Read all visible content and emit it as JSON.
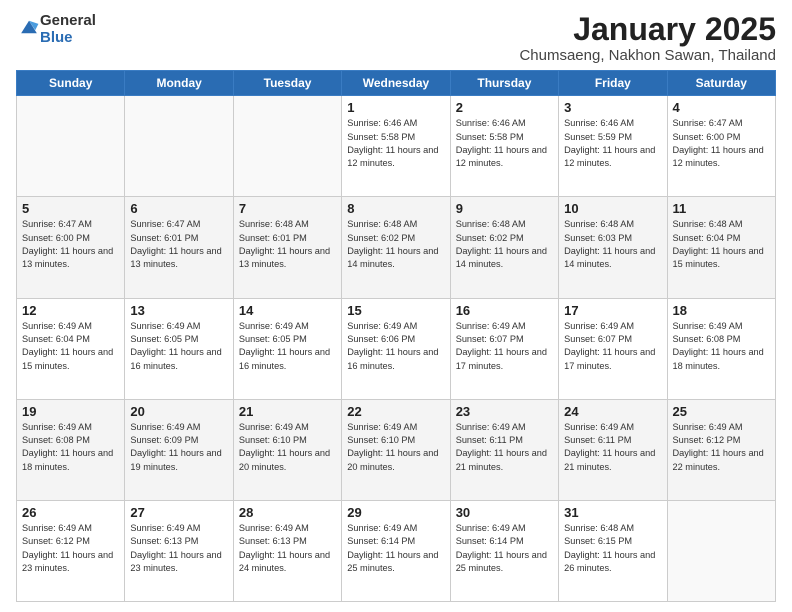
{
  "header": {
    "logo_general": "General",
    "logo_blue": "Blue",
    "title": "January 2025",
    "subtitle": "Chumsaeng, Nakhon Sawan, Thailand"
  },
  "days_of_week": [
    "Sunday",
    "Monday",
    "Tuesday",
    "Wednesday",
    "Thursday",
    "Friday",
    "Saturday"
  ],
  "weeks": [
    [
      {
        "day": "",
        "info": ""
      },
      {
        "day": "",
        "info": ""
      },
      {
        "day": "",
        "info": ""
      },
      {
        "day": "1",
        "info": "Sunrise: 6:46 AM\nSunset: 5:58 PM\nDaylight: 11 hours and 12 minutes."
      },
      {
        "day": "2",
        "info": "Sunrise: 6:46 AM\nSunset: 5:58 PM\nDaylight: 11 hours and 12 minutes."
      },
      {
        "day": "3",
        "info": "Sunrise: 6:46 AM\nSunset: 5:59 PM\nDaylight: 11 hours and 12 minutes."
      },
      {
        "day": "4",
        "info": "Sunrise: 6:47 AM\nSunset: 6:00 PM\nDaylight: 11 hours and 12 minutes."
      }
    ],
    [
      {
        "day": "5",
        "info": "Sunrise: 6:47 AM\nSunset: 6:00 PM\nDaylight: 11 hours and 13 minutes."
      },
      {
        "day": "6",
        "info": "Sunrise: 6:47 AM\nSunset: 6:01 PM\nDaylight: 11 hours and 13 minutes."
      },
      {
        "day": "7",
        "info": "Sunrise: 6:48 AM\nSunset: 6:01 PM\nDaylight: 11 hours and 13 minutes."
      },
      {
        "day": "8",
        "info": "Sunrise: 6:48 AM\nSunset: 6:02 PM\nDaylight: 11 hours and 14 minutes."
      },
      {
        "day": "9",
        "info": "Sunrise: 6:48 AM\nSunset: 6:02 PM\nDaylight: 11 hours and 14 minutes."
      },
      {
        "day": "10",
        "info": "Sunrise: 6:48 AM\nSunset: 6:03 PM\nDaylight: 11 hours and 14 minutes."
      },
      {
        "day": "11",
        "info": "Sunrise: 6:48 AM\nSunset: 6:04 PM\nDaylight: 11 hours and 15 minutes."
      }
    ],
    [
      {
        "day": "12",
        "info": "Sunrise: 6:49 AM\nSunset: 6:04 PM\nDaylight: 11 hours and 15 minutes."
      },
      {
        "day": "13",
        "info": "Sunrise: 6:49 AM\nSunset: 6:05 PM\nDaylight: 11 hours and 16 minutes."
      },
      {
        "day": "14",
        "info": "Sunrise: 6:49 AM\nSunset: 6:05 PM\nDaylight: 11 hours and 16 minutes."
      },
      {
        "day": "15",
        "info": "Sunrise: 6:49 AM\nSunset: 6:06 PM\nDaylight: 11 hours and 16 minutes."
      },
      {
        "day": "16",
        "info": "Sunrise: 6:49 AM\nSunset: 6:07 PM\nDaylight: 11 hours and 17 minutes."
      },
      {
        "day": "17",
        "info": "Sunrise: 6:49 AM\nSunset: 6:07 PM\nDaylight: 11 hours and 17 minutes."
      },
      {
        "day": "18",
        "info": "Sunrise: 6:49 AM\nSunset: 6:08 PM\nDaylight: 11 hours and 18 minutes."
      }
    ],
    [
      {
        "day": "19",
        "info": "Sunrise: 6:49 AM\nSunset: 6:08 PM\nDaylight: 11 hours and 18 minutes."
      },
      {
        "day": "20",
        "info": "Sunrise: 6:49 AM\nSunset: 6:09 PM\nDaylight: 11 hours and 19 minutes."
      },
      {
        "day": "21",
        "info": "Sunrise: 6:49 AM\nSunset: 6:10 PM\nDaylight: 11 hours and 20 minutes."
      },
      {
        "day": "22",
        "info": "Sunrise: 6:49 AM\nSunset: 6:10 PM\nDaylight: 11 hours and 20 minutes."
      },
      {
        "day": "23",
        "info": "Sunrise: 6:49 AM\nSunset: 6:11 PM\nDaylight: 11 hours and 21 minutes."
      },
      {
        "day": "24",
        "info": "Sunrise: 6:49 AM\nSunset: 6:11 PM\nDaylight: 11 hours and 21 minutes."
      },
      {
        "day": "25",
        "info": "Sunrise: 6:49 AM\nSunset: 6:12 PM\nDaylight: 11 hours and 22 minutes."
      }
    ],
    [
      {
        "day": "26",
        "info": "Sunrise: 6:49 AM\nSunset: 6:12 PM\nDaylight: 11 hours and 23 minutes."
      },
      {
        "day": "27",
        "info": "Sunrise: 6:49 AM\nSunset: 6:13 PM\nDaylight: 11 hours and 23 minutes."
      },
      {
        "day": "28",
        "info": "Sunrise: 6:49 AM\nSunset: 6:13 PM\nDaylight: 11 hours and 24 minutes."
      },
      {
        "day": "29",
        "info": "Sunrise: 6:49 AM\nSunset: 6:14 PM\nDaylight: 11 hours and 25 minutes."
      },
      {
        "day": "30",
        "info": "Sunrise: 6:49 AM\nSunset: 6:14 PM\nDaylight: 11 hours and 25 minutes."
      },
      {
        "day": "31",
        "info": "Sunrise: 6:48 AM\nSunset: 6:15 PM\nDaylight: 11 hours and 26 minutes."
      },
      {
        "day": "",
        "info": ""
      }
    ]
  ]
}
